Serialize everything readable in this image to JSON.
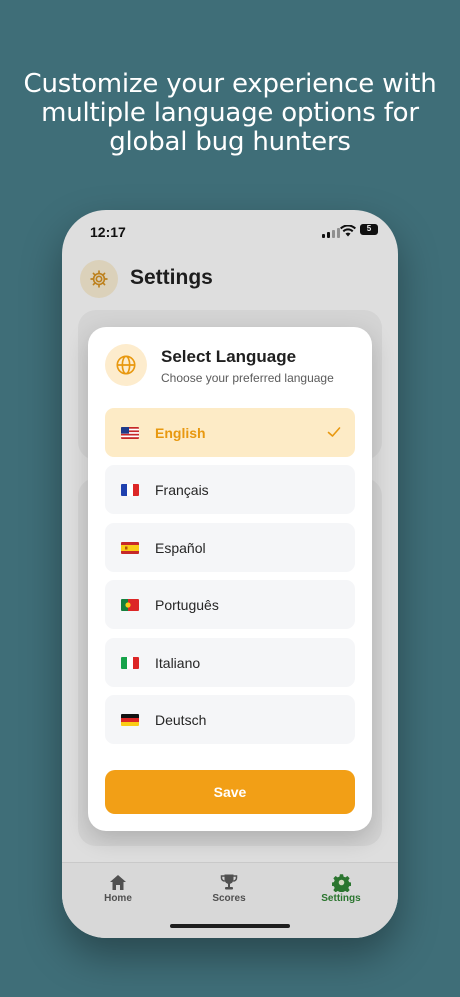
{
  "headline": "Customize your experience with multiple language options for global bug hunters",
  "status_bar": {
    "time": "12:17",
    "battery": "5"
  },
  "app": {
    "title": "Settings"
  },
  "tabs": [
    {
      "label": "Home",
      "icon": "home-icon"
    },
    {
      "label": "Scores",
      "icon": "trophy-icon"
    },
    {
      "label": "Settings",
      "icon": "gear-icon",
      "active": true
    }
  ],
  "modal": {
    "title": "Select Language",
    "subtitle": "Choose your preferred language",
    "languages": [
      {
        "label": "English",
        "flag": "us-flag-icon",
        "selected": true
      },
      {
        "label": "Français",
        "flag": "fr-flag-icon"
      },
      {
        "label": "Español",
        "flag": "es-flag-icon"
      },
      {
        "label": "Português",
        "flag": "pt-flag-icon"
      },
      {
        "label": "Italiano",
        "flag": "it-flag-icon"
      },
      {
        "label": "Deutsch",
        "flag": "de-flag-icon"
      }
    ],
    "save_label": "Save"
  },
  "colors": {
    "background": "#3f6e78",
    "accent": "#f29f16",
    "selected_bg": "#fdebc6",
    "active_tab": "#2e7d32"
  }
}
